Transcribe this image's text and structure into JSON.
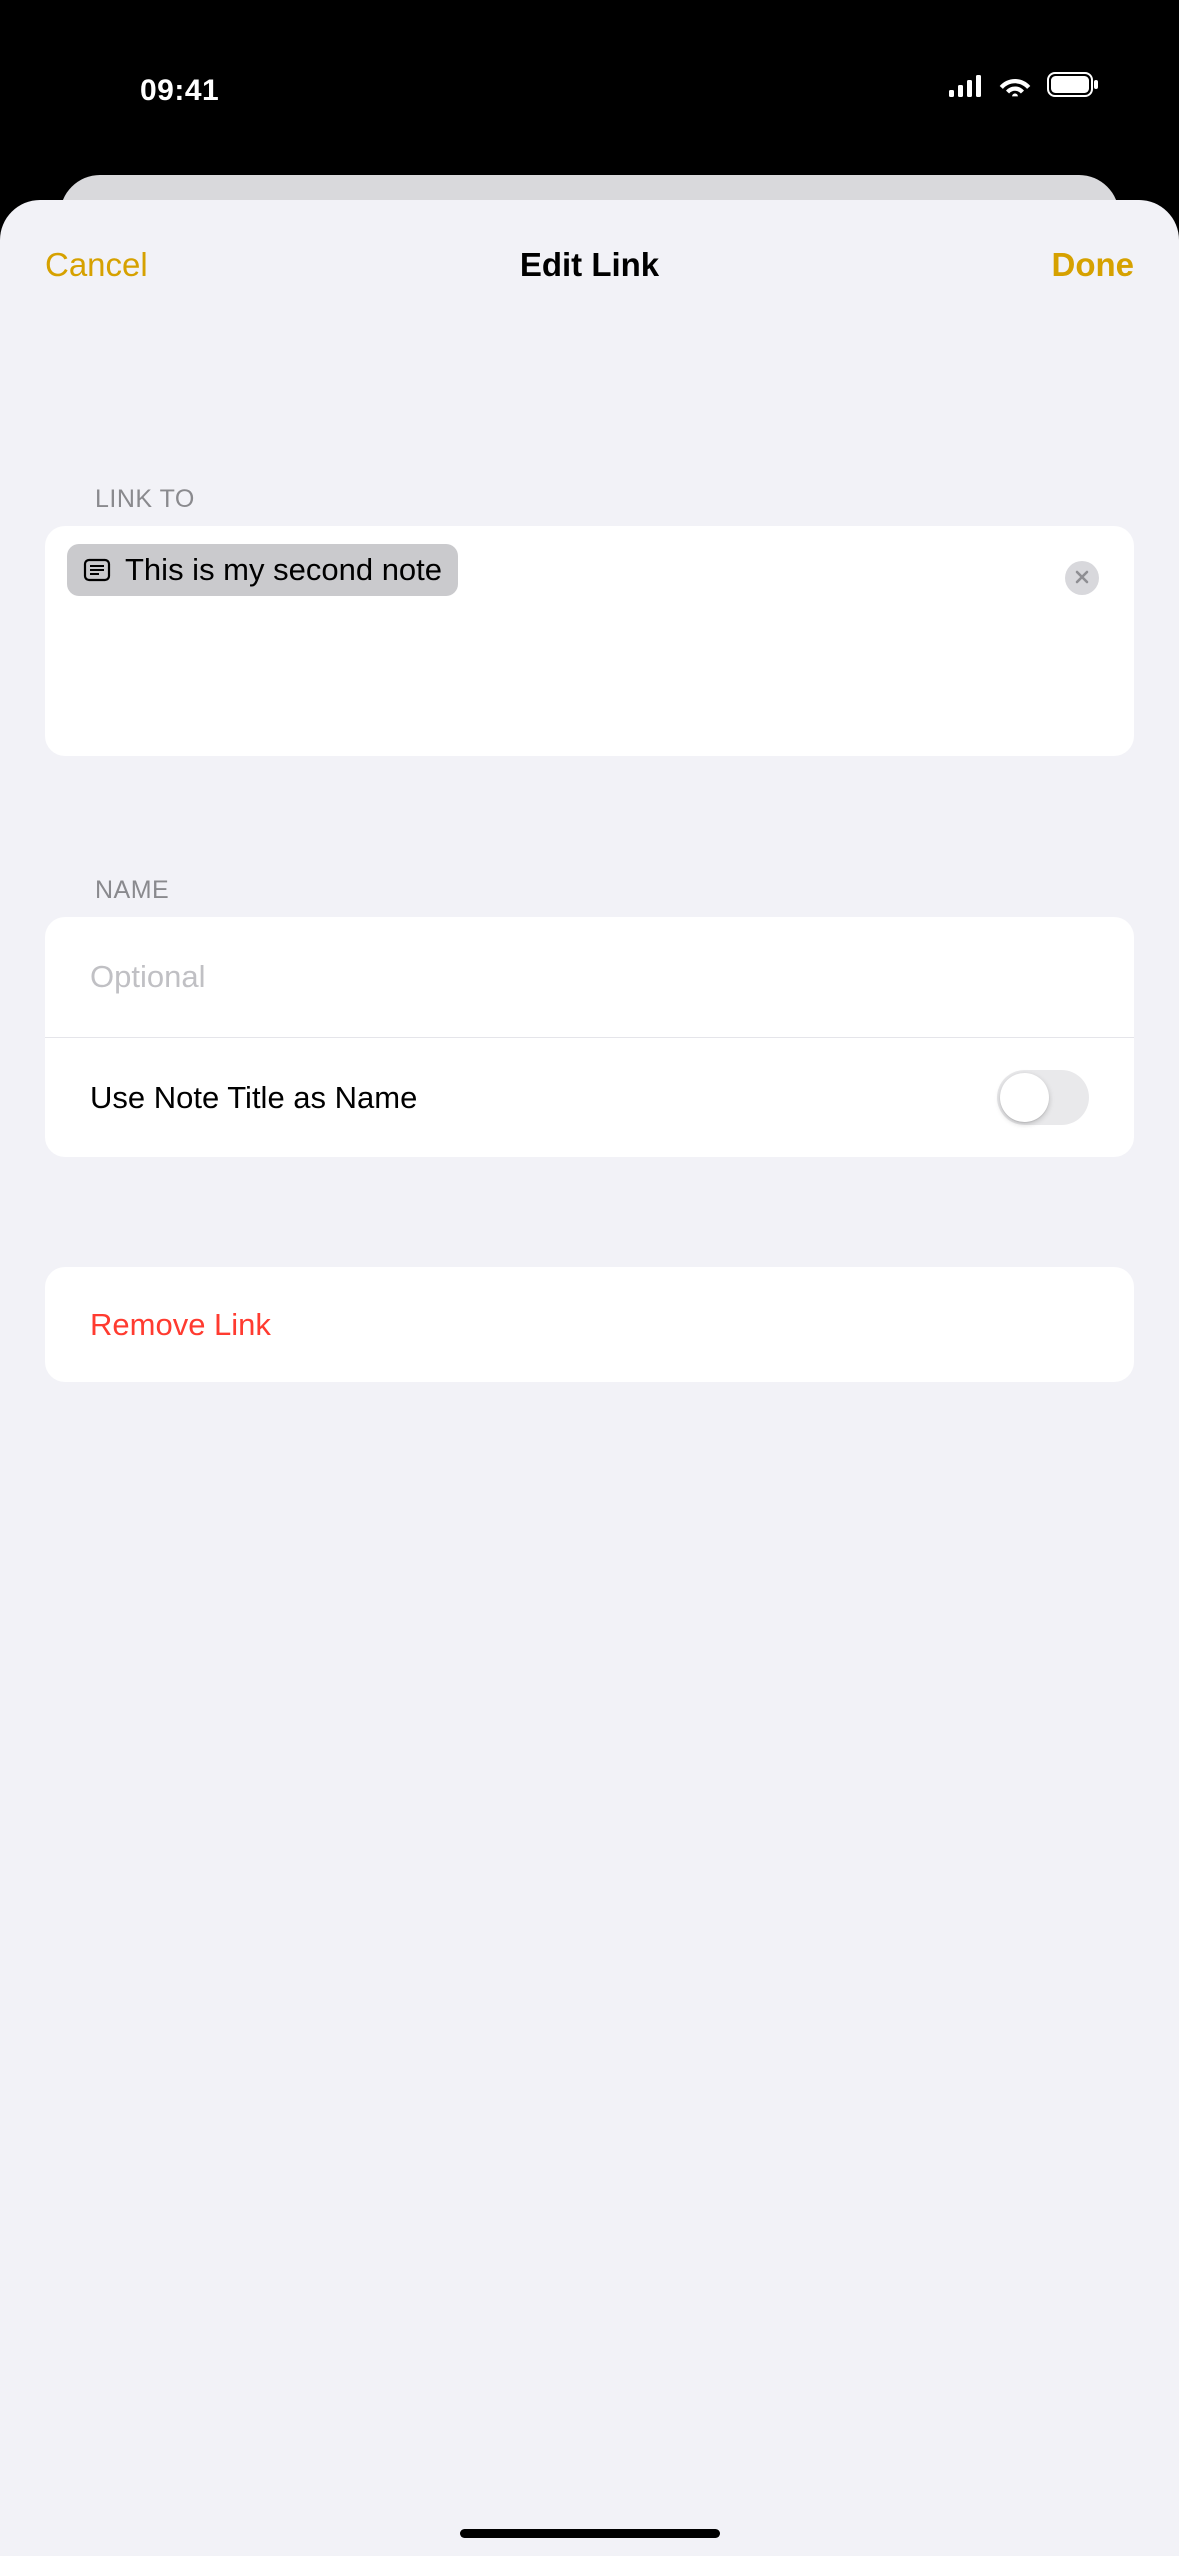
{
  "status": {
    "time": "09:41"
  },
  "nav": {
    "cancel": "Cancel",
    "title": "Edit Link",
    "done": "Done"
  },
  "sections": {
    "link_to_header": "LINK TO",
    "name_header": "NAME"
  },
  "link_to": {
    "token_label": "This is my second note"
  },
  "name": {
    "placeholder": "Optional",
    "value": "",
    "use_title_label": "Use Note Title as Name",
    "use_title_on": false
  },
  "remove": {
    "label": "Remove Link"
  },
  "colors": {
    "accent": "#d6a100",
    "destructive": "#ff3b30"
  }
}
